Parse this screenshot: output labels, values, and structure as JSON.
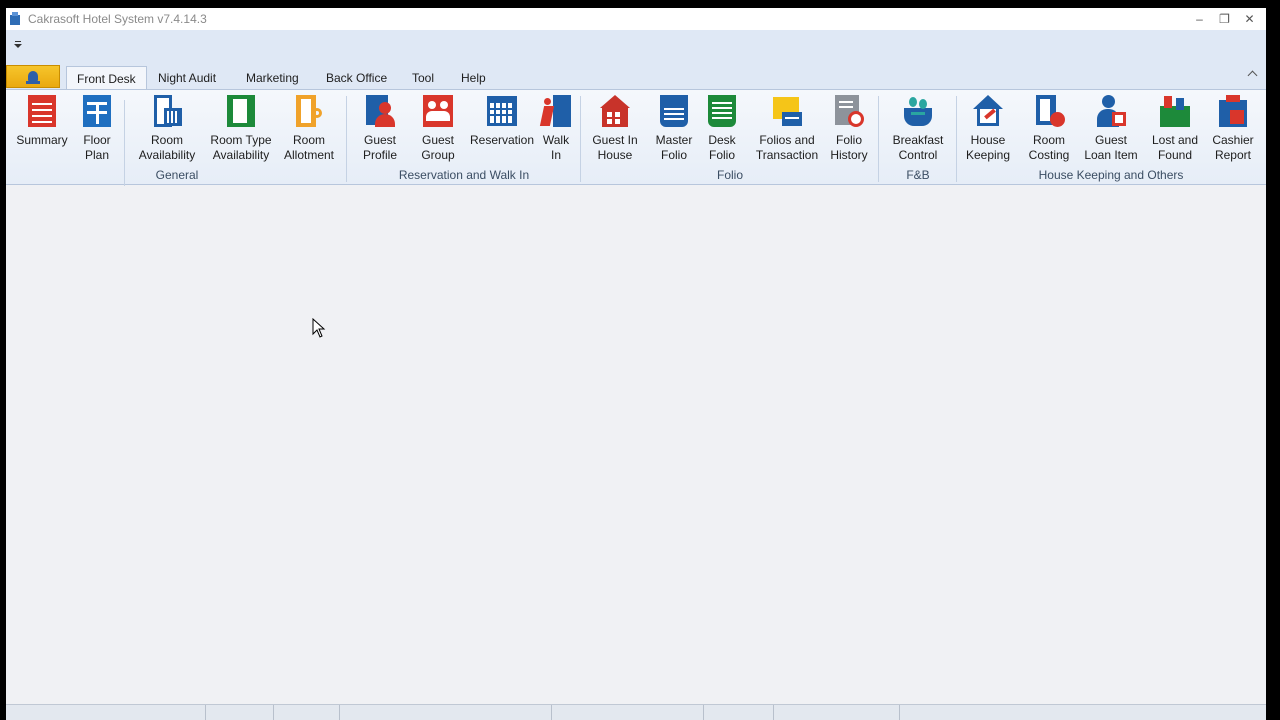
{
  "window": {
    "title": "Cakrasoft Hotel System v7.4.14.3",
    "minimize": "–",
    "maximize": "❐",
    "close": "✕"
  },
  "tabs": [
    {
      "label": "Front Desk",
      "active": true
    },
    {
      "label": "Night Audit"
    },
    {
      "label": "Marketing"
    },
    {
      "label": "Back Office"
    },
    {
      "label": "Tool"
    },
    {
      "label": "Help"
    }
  ],
  "groups": {
    "general": "General",
    "reservation": "Reservation and Walk In",
    "folio": "Folio",
    "fnb": "F&B",
    "housekeeping": "House Keeping and Others"
  },
  "buttons": {
    "summary": "Summary",
    "floor_plan": "Floor\nPlan",
    "room_availability": "Room\nAvailability",
    "room_type_availability": "Room Type\nAvailability",
    "room_allotment": "Room\nAllotment",
    "guest_profile": "Guest\nProfile",
    "guest_group": "Guest\nGroup",
    "reservation": "Reservation",
    "walk_in": "Walk\nIn",
    "guest_in_house": "Guest In\nHouse",
    "master_folio": "Master\nFolio",
    "desk_folio": "Desk\nFolio",
    "folios_transaction": "Folios and\nTransaction",
    "folio_history": "Folio\nHistory",
    "breakfast_control": "Breakfast\nControl",
    "house_keeping": "House\nKeeping",
    "room_costing": "Room\nCosting",
    "guest_loan_item": "Guest\nLoan Item",
    "lost_and_found": "Lost and\nFound",
    "cashier_report": "Cashier\nReport"
  },
  "colors": {
    "accent_blue": "#1f5fa8",
    "red": "#d9362b",
    "green": "#1d8a3a",
    "orange": "#f0a22a",
    "app_button": "#f0b31c"
  }
}
